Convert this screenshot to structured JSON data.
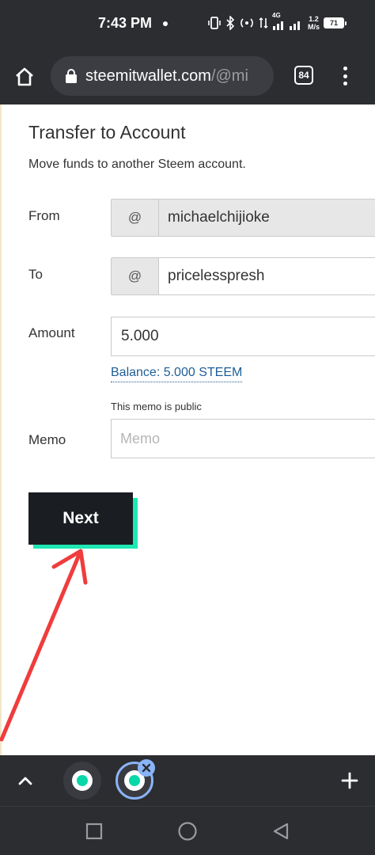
{
  "status_bar": {
    "time": "7:43 PM",
    "network_type": "4G",
    "net_speed_value": "1.2",
    "net_speed_unit": "M/s",
    "battery_level": "71"
  },
  "browser": {
    "url_domain": "steemitwallet.com",
    "url_path": "/@mi",
    "tab_count": "84"
  },
  "form": {
    "title": "Transfer to Account",
    "subtitle": "Move funds to another Steem account.",
    "from_label": "From",
    "from_prefix": "@",
    "from_value": "michaelchijioke",
    "to_label": "To",
    "to_prefix": "@",
    "to_value": "pricelesspresh",
    "amount_label": "Amount",
    "amount_value": "5.000",
    "balance_text": "Balance: 5.000 STEEM",
    "memo_note": "This memo is public",
    "memo_label": "Memo",
    "memo_placeholder": "Memo",
    "next_label": "Next"
  },
  "colors": {
    "accent": "#1ee8b3",
    "button": "#1a1e22",
    "link": "#1f5e95",
    "annotation_arrow": "#f03c3c",
    "chrome_dark": "#2c2d31"
  },
  "icons": {
    "home": "home-icon",
    "lock": "lock-icon",
    "menu": "more-vert-icon",
    "chevron": "chevron-up-icon",
    "new_tab": "plus-icon",
    "close": "close-icon"
  }
}
